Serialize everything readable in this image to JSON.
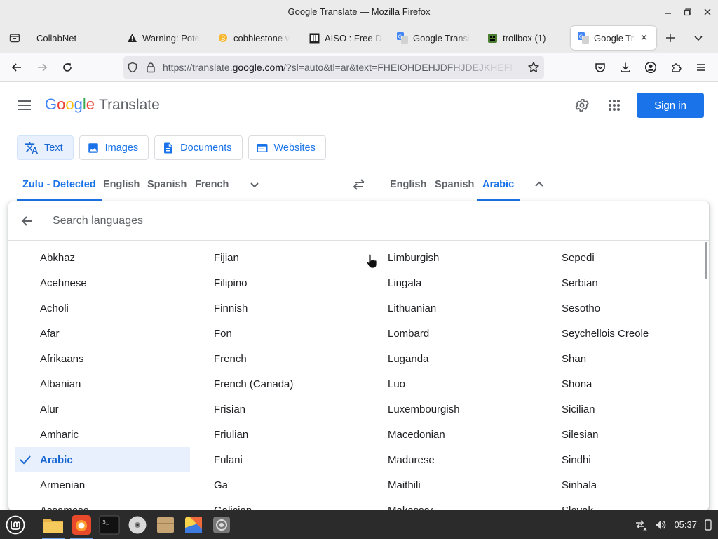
{
  "window": {
    "title": "Google Translate — Mozilla Firefox"
  },
  "tabs": [
    {
      "label": "CollabNet",
      "icon": "none"
    },
    {
      "label": "Warning: Pote",
      "icon": "warning-icon"
    },
    {
      "label": "cobblestone v",
      "icon": "bitcoin-icon"
    },
    {
      "label": "AISO : Free Do",
      "icon": "aiso-icon"
    },
    {
      "label": "Google Transl",
      "icon": "google-translate-icon"
    },
    {
      "label": "trollbox (1)",
      "icon": "trollbox-icon"
    },
    {
      "label": "Google Tran",
      "icon": "google-translate-icon",
      "active": true
    }
  ],
  "url": {
    "prefix": "https://translate.",
    "host": "google.com",
    "rest": "/?sl=auto&tl=ar&text=FHEIOHDEHJDFHJDEJKHEFI"
  },
  "header": {
    "logo_letters": [
      "G",
      "o",
      "o",
      "g",
      "l",
      "e"
    ],
    "product": "Translate",
    "signin": "Sign in"
  },
  "modes": [
    {
      "label": "Text",
      "icon": "translate-icon",
      "active": true
    },
    {
      "label": "Images",
      "icon": "image-icon"
    },
    {
      "label": "Documents",
      "icon": "document-icon"
    },
    {
      "label": "Websites",
      "icon": "website-icon"
    }
  ],
  "source_langs": [
    "Zulu - Detected",
    "English",
    "Spanish",
    "French"
  ],
  "target_langs": [
    "English",
    "Spanish",
    "Arabic"
  ],
  "picker": {
    "search_placeholder": "Search languages",
    "selected": "Arabic",
    "columns": [
      [
        "Abkhaz",
        "Acehnese",
        "Acholi",
        "Afar",
        "Afrikaans",
        "Albanian",
        "Alur",
        "Amharic",
        "Arabic",
        "Armenian",
        "Assamese"
      ],
      [
        "Fijian",
        "Filipino",
        "Finnish",
        "Fon",
        "French",
        "French (Canada)",
        "Frisian",
        "Friulian",
        "Fulani",
        "Ga",
        "Galician"
      ],
      [
        "Limburgish",
        "Lingala",
        "Lithuanian",
        "Lombard",
        "Luganda",
        "Luo",
        "Luxembourgish",
        "Macedonian",
        "Madurese",
        "Maithili",
        "Makassar"
      ],
      [
        "Sepedi",
        "Serbian",
        "Sesotho",
        "Seychellois Creole",
        "Shan",
        "Shona",
        "Sicilian",
        "Silesian",
        "Sindhi",
        "Sinhala",
        "Slovak"
      ]
    ]
  },
  "taskbar": {
    "clock": "05:37"
  },
  "colors": {
    "accent": "#1a73e8",
    "selected_bg": "#e8f0fe"
  }
}
